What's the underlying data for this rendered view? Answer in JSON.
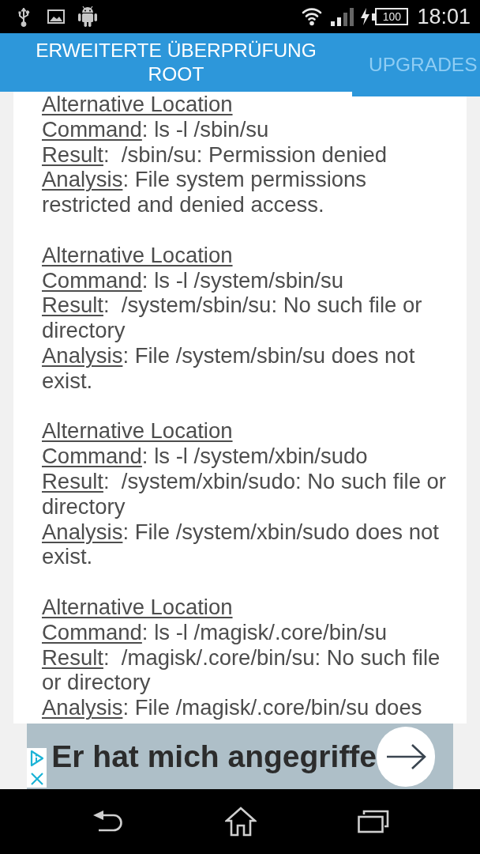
{
  "status_bar": {
    "battery": "100",
    "time": "18:01"
  },
  "tabs": [
    {
      "label": "ERWEITERTE ÜBERPRÜFUNG ROOT",
      "selected": true
    },
    {
      "label": "UPGRADES",
      "selected": false
    }
  ],
  "checks": [
    {
      "heading": "Alternative Location",
      "fields": [
        {
          "label": "Command",
          "rest": ": ls -l /sbin/su"
        },
        {
          "label": "Result",
          "rest": ":  /sbin/su: Permission denied"
        },
        {
          "label": "Analysis",
          "rest": ": File system permissions restricted and denied access."
        }
      ]
    },
    {
      "heading": "Alternative Location",
      "fields": [
        {
          "label": "Command",
          "rest": ": ls -l /system/sbin/su"
        },
        {
          "label": "Result",
          "rest": ":  /system/sbin/su: No such file or directory"
        },
        {
          "label": "Analysis",
          "rest": ": File /system/sbin/su does not exist."
        }
      ]
    },
    {
      "heading": "Alternative Location",
      "fields": [
        {
          "label": "Command",
          "rest": ": ls -l /system/xbin/sudo"
        },
        {
          "label": "Result",
          "rest": ":  /system/xbin/sudo: No such file or directory"
        },
        {
          "label": "Analysis",
          "rest": ": File /system/xbin/sudo does not exist."
        }
      ]
    },
    {
      "heading": "Alternative Location",
      "fields": [
        {
          "label": "Command",
          "rest": ": ls -l /magisk/.core/bin/su"
        },
        {
          "label": "Result",
          "rest": ":  /magisk/.core/bin/su: No such file or directory"
        },
        {
          "label": "Analysis",
          "rest": ": File /magisk/.core/bin/su does"
        }
      ]
    }
  ],
  "ad": {
    "headline": "Er hat mich angegriffe"
  }
}
